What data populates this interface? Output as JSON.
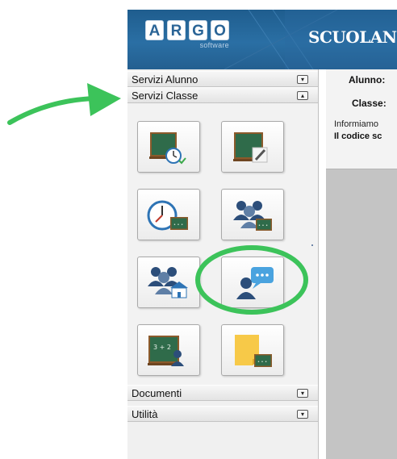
{
  "header": {
    "logo_letters": [
      "A",
      "R",
      "G",
      "O"
    ],
    "logo_sub": "software",
    "app_name": "SCUOLANE"
  },
  "sidebar": {
    "sections": [
      {
        "label": "Servizi Alunno",
        "toggle": "▾"
      },
      {
        "label": "Servizi Classe",
        "toggle": "▴"
      },
      {
        "label": "Documenti",
        "toggle": "▾"
      },
      {
        "label": "Utilità",
        "toggle": "▾"
      }
    ],
    "tiles": [
      {
        "icon": "blackboard-clock-icon"
      },
      {
        "icon": "blackboard-pencil-icon"
      },
      {
        "icon": "clock-blackboard-icon"
      },
      {
        "icon": "group-blackboard-icon"
      },
      {
        "icon": "group-school-icon"
      },
      {
        "icon": "person-speech-bubble-icon",
        "highlighted": true
      },
      {
        "icon": "blackboard-math-person-icon"
      },
      {
        "icon": "sticky-note-blackboard-icon"
      }
    ]
  },
  "main": {
    "alunno_label": "Alunno:",
    "classe_label": "Classe:",
    "info_text": "Informiamo",
    "codice_text": "Il codice sc"
  },
  "annotations": {
    "arrow_color": "#3cc35a",
    "circle_color": "#3cc35a"
  }
}
